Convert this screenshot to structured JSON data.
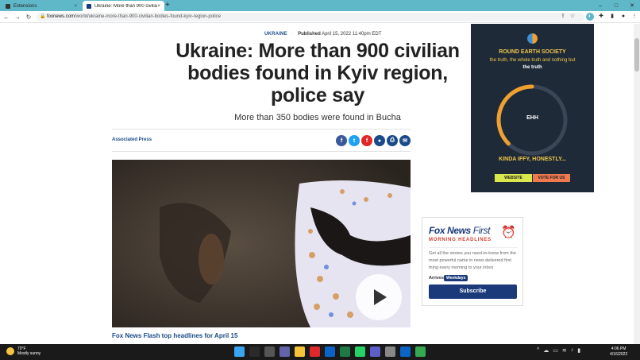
{
  "browser": {
    "tabs": [
      {
        "title": "Extensions",
        "active": false,
        "icon": "puzzle-icon"
      },
      {
        "title": "Ukraine: More than 900 civilian b",
        "active": true,
        "icon": "foxnews-favicon"
      }
    ],
    "new_tab_label": "+",
    "close_tab_label": "×",
    "url_domain": "foxnews.com",
    "url_path": "/world/ukraine-more-than-900-civilian-bodies-found-kyiv-region-police",
    "nav": {
      "back": "←",
      "forward": "→",
      "reload": "↻"
    },
    "window_controls": {
      "minimize": "–",
      "maximize": "□",
      "close": "✕"
    }
  },
  "article": {
    "category": "UKRAINE",
    "published_label": "Published",
    "published_date": "April 15, 2022 11:40pm EDT",
    "headline": "Ukraine: More than 900 civilian bodies found in Kyiv region, police say",
    "subheadline": "More than 350 bodies were found in Bucha",
    "byline": "Associated Press",
    "share_buttons": [
      {
        "name": "facebook",
        "glyph": "f",
        "color": "#3b5998"
      },
      {
        "name": "twitter",
        "glyph": "t",
        "color": "#1da1f2"
      },
      {
        "name": "flipboard",
        "glyph": "f",
        "color": "#e12828"
      },
      {
        "name": "comments",
        "glyph": "●",
        "color": "#1a4a8a"
      },
      {
        "name": "print",
        "glyph": "⎙",
        "color": "#1a4a8a"
      },
      {
        "name": "email",
        "glyph": "✉",
        "color": "#1a4a8a"
      }
    ],
    "video_caption": "Fox News Flash top headlines for April 15"
  },
  "ad": {
    "title": "ROUND EARTH SOCIETY",
    "tagline_part1": "the truth, the whole truth and nothing but",
    "tagline_bold": "the truth",
    "gauge_value": "EHH",
    "gauge_level": 0.5,
    "verdict": "KINDA IFFY, HONESTLY...",
    "website_label": "WEBSITE",
    "vote_label": "VOTE FOR US",
    "gauge_color": "#f0a030",
    "bg_color": "#1f2a38"
  },
  "newsletter": {
    "brand_main": "Fox News",
    "brand_first": "First",
    "subtitle": "MORNING HEADLINES",
    "body": "Get all the stories you need-to-know from the most powerful name in news delivered first thing every morning to your inbox",
    "arrives_label": "Arrives",
    "arrives_value": "Weekdays",
    "subscribe_label": "Subscribe"
  },
  "taskbar": {
    "temperature": "70°F",
    "condition": "Mostly sunny",
    "time": "4:06 PM",
    "date": "4/16/2022",
    "apps": [
      {
        "name": "windows-start-icon",
        "color": "#3ba4f0"
      },
      {
        "name": "search-icon",
        "color": "#2a2a2a"
      },
      {
        "name": "task-view-icon",
        "color": "#555"
      },
      {
        "name": "teams-icon",
        "color": "#6264a7"
      },
      {
        "name": "file-explorer-icon",
        "color": "#f3c43a"
      },
      {
        "name": "opera-icon",
        "color": "#e0282c"
      },
      {
        "name": "outlook-icon",
        "color": "#0a64c8"
      },
      {
        "name": "excel-icon",
        "color": "#1d7a44"
      },
      {
        "name": "whatsapp-icon",
        "color": "#25d366"
      },
      {
        "name": "teams-icon-2",
        "color": "#5b5fc7"
      },
      {
        "name": "settings-icon",
        "color": "#888"
      },
      {
        "name": "security-icon",
        "color": "#0a64c8"
      },
      {
        "name": "chrome-icon",
        "color": "#34a853"
      }
    ]
  }
}
